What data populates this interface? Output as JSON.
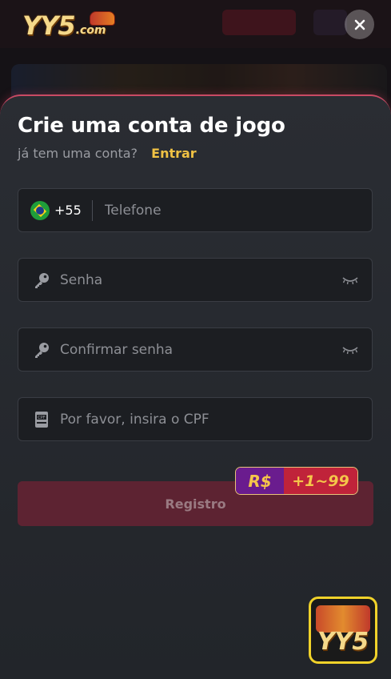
{
  "header": {
    "logo_main": "YY5",
    "logo_suffix": ".com"
  },
  "form": {
    "title": "Crie uma conta de jogo",
    "subtitle": "já tem uma conta?",
    "login_link": "Entrar",
    "phone": {
      "country_code": "+55",
      "placeholder": "Telefone",
      "flag": "brazil-flag"
    },
    "password": {
      "placeholder": "Senha",
      "icon": "key-icon"
    },
    "confirm_password": {
      "placeholder": "Confirmar senha",
      "icon": "key-icon"
    },
    "cpf": {
      "placeholder": "Por favor, insira o CPF",
      "icon": "cpf-card-icon"
    },
    "register_label": "Registro",
    "bonus": {
      "currency": "R$",
      "range": "+1~99"
    }
  },
  "app_badge": {
    "label": "YY5"
  },
  "colors": {
    "accent_yellow": "#f0c244",
    "register_bg": "#5d2332",
    "sheet_border": "#c94a64"
  }
}
